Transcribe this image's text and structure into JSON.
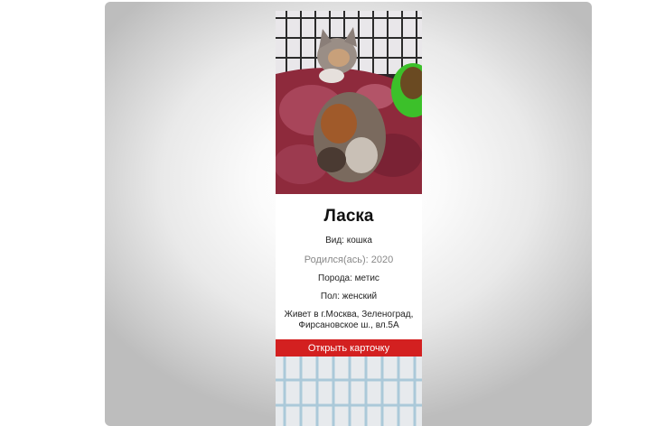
{
  "card": {
    "photo": "cat-photo",
    "name": "Ласка",
    "species": "Вид: кошка",
    "born": "Родился(ась): 2020",
    "breed": "Порода: метис",
    "sex": "Пол: женский",
    "address_line1": "Живет в г.Москва, Зеленоград,",
    "address_line2": "Фирсановское ш., вл.5А",
    "button_label": "Открыть карточку"
  },
  "next_card": {
    "photo": "cage-photo"
  },
  "colors": {
    "accent": "#d32020",
    "muted_text": "#888888"
  }
}
